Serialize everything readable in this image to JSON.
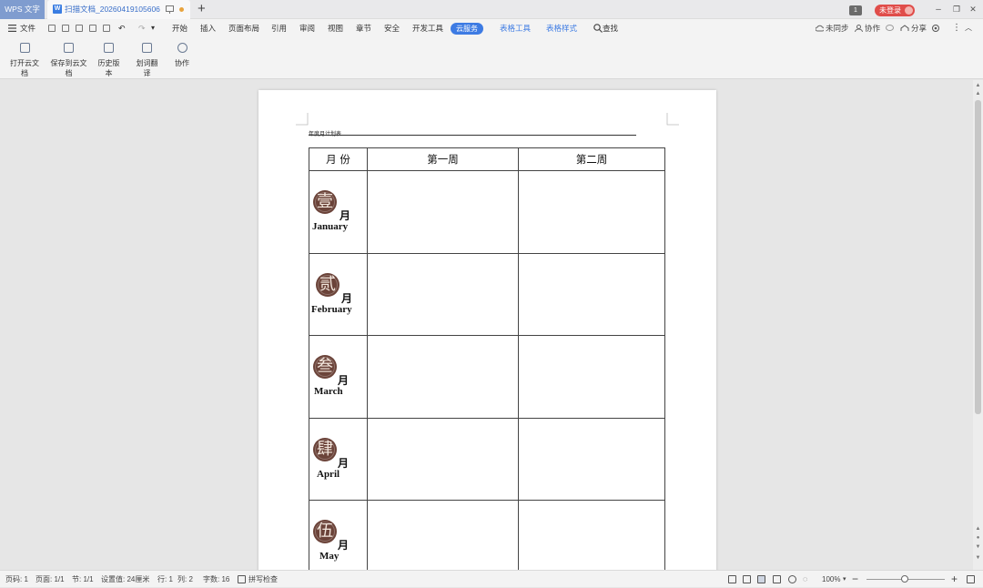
{
  "titlebar": {
    "app_tab": "WPS 文字",
    "doc_tab": "扫描文档_20260419105606",
    "doc_icon": "W",
    "new_tab": "+",
    "page_badge": "1",
    "login_label": "未登录",
    "win_min": "–",
    "win_restore": "❐",
    "win_close": "✕"
  },
  "menubar": {
    "file": "文件",
    "items": [
      "开始",
      "插入",
      "页面布局",
      "引用",
      "审阅",
      "视图",
      "章节",
      "安全",
      "开发工具"
    ],
    "active": "云服务",
    "context_tabs": [
      "表格工具",
      "表格样式"
    ],
    "search": "查找",
    "sync": "未同步",
    "collab": "协作",
    "share": "分享"
  },
  "ribbon": {
    "buttons": [
      "打开云文档",
      "保存到云文档",
      "历史版本",
      "划词翻译",
      "协作"
    ]
  },
  "document": {
    "header_text": "年度月计划表",
    "table": {
      "headers": [
        "月 份",
        "第一周",
        "第二周"
      ],
      "rows": [
        {
          "seal": "壹",
          "yue": "月",
          "en": "January"
        },
        {
          "seal": "贰",
          "yue": "月",
          "en": "February"
        },
        {
          "seal": "叁",
          "yue": "月",
          "en": "March"
        },
        {
          "seal": "肆",
          "yue": "月",
          "en": "April"
        },
        {
          "seal": "伍",
          "yue": "月",
          "en": "May"
        }
      ]
    }
  },
  "statusbar": {
    "page": "页码: 1",
    "pages": "页面: 1/1",
    "section": "节: 1/1",
    "setting": "设置值: 24厘米",
    "row": "行: 1",
    "col": "列: 2",
    "words": "字数: 16",
    "spell": "拼写检查",
    "zoom": "100%",
    "zoom_level": 0.5
  },
  "colors": {
    "accent": "#3d7be3",
    "app_tab": "#7f9ccf",
    "login": "#e04d4a",
    "seal": "#6b4339"
  }
}
